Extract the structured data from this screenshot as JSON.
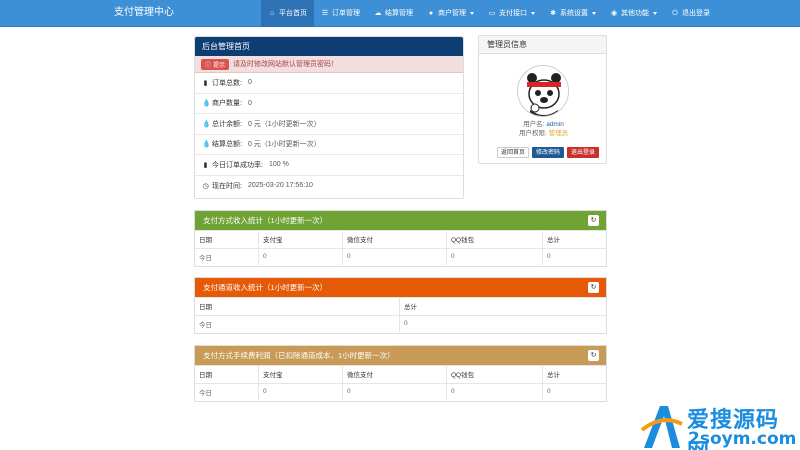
{
  "navbar": {
    "brand": "支付管理中心",
    "items": [
      {
        "label": "平台首页",
        "icon": "home-icon",
        "active": true,
        "dropdown": false
      },
      {
        "label": "订单管理",
        "icon": "list-icon",
        "active": false,
        "dropdown": false
      },
      {
        "label": "结算管理",
        "icon": "cloud-icon",
        "active": false,
        "dropdown": false
      },
      {
        "label": "商户管理",
        "icon": "user-icon",
        "active": false,
        "dropdown": true
      },
      {
        "label": "支付接口",
        "icon": "card-icon",
        "active": false,
        "dropdown": true
      },
      {
        "label": "系统设置",
        "icon": "gear-icon",
        "active": false,
        "dropdown": true
      },
      {
        "label": "其他功能",
        "icon": "globe-icon",
        "active": false,
        "dropdown": true
      },
      {
        "label": "退出登录",
        "icon": "power-icon",
        "active": false,
        "dropdown": false
      }
    ]
  },
  "home": {
    "title": "后台管理首页",
    "alert_tag": "提示",
    "alert_text": "请及时修改网站默认管理员密码！",
    "rows": [
      {
        "label": "订单总数:",
        "value": "0",
        "icon": "bar-chart-icon"
      },
      {
        "label": "商户数量:",
        "value": "0",
        "icon": "tint-icon"
      },
      {
        "label": "总计余额:",
        "value": "0 元（1小时更新一次）",
        "icon": "tint-icon"
      },
      {
        "label": "结算总额:",
        "value": "0 元（1小时更新一次）",
        "icon": "tint-icon"
      },
      {
        "label": "今日订单成功率:",
        "value": "100 %",
        "icon": "bar-chart-icon"
      },
      {
        "label": "现在时间:",
        "value": "2025-03-20 17:56:10",
        "icon": "clock-icon"
      }
    ]
  },
  "admin": {
    "title": "管理员信息",
    "username_label": "用户名:",
    "username": "admin",
    "role_label": "用户权限:",
    "role": "管理员",
    "buttons": {
      "home": "返回首页",
      "password": "修改密码",
      "logout": "退出登录"
    }
  },
  "pay_stats": {
    "title": "支付方式收入统计（1小时更新一次）",
    "color": "#6fa334",
    "headers": [
      "日期",
      "支付宝",
      "微信支付",
      "QQ钱包",
      "总计"
    ],
    "rows": [
      [
        "今日",
        "0",
        "0",
        "0",
        "0"
      ]
    ]
  },
  "channel_stats": {
    "title": "支付通道收入统计（1小时更新一次）",
    "color": "#e55a06",
    "headers": [
      "日期",
      "总计"
    ],
    "rows": [
      [
        "今日",
        "0"
      ]
    ]
  },
  "fee_stats": {
    "title": "支付方式手续费利润（已扣除通道成本，1小时更新一次）",
    "color": "#c79b55",
    "headers": [
      "日期",
      "支付宝",
      "微信支付",
      "QQ钱包",
      "总计"
    ],
    "rows": [
      [
        "今日",
        "0",
        "0",
        "0",
        "0"
      ]
    ]
  },
  "watermark": {
    "line1": "爱搜源码网",
    "line2": "2soym.com"
  }
}
